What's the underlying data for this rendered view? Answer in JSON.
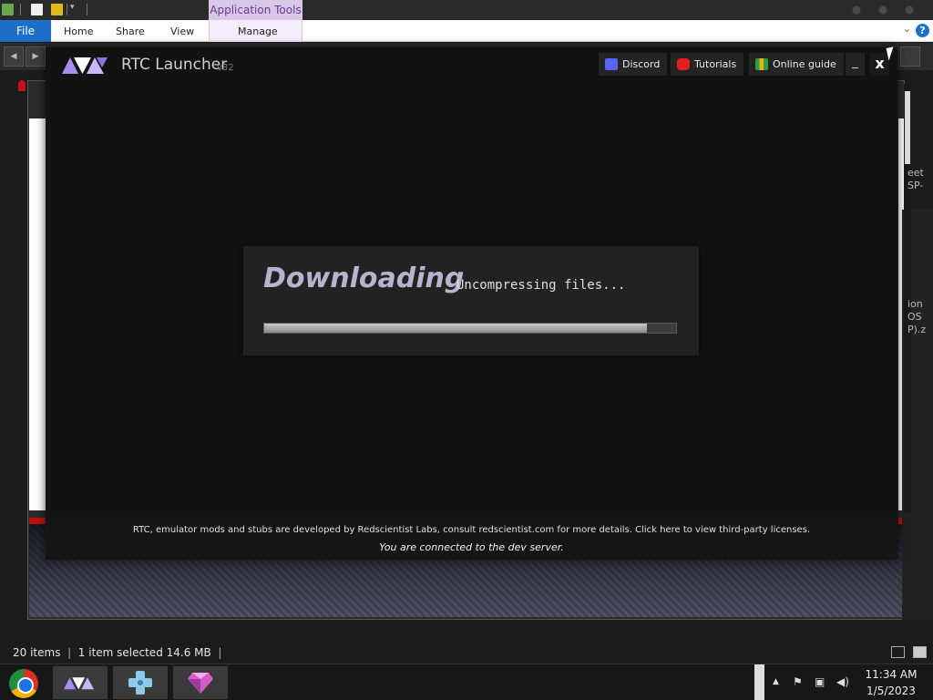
{
  "explorer": {
    "context_tab": "Application Tools",
    "ribbon_tabs": {
      "file": "File",
      "home": "Home",
      "share": "Share",
      "view": "View",
      "manage": "Manage"
    },
    "side_text": [
      "eet",
      "SP-",
      "ion",
      "OS",
      "P).z"
    ]
  },
  "launcher": {
    "title": "RTC Launcher",
    "version": "v32",
    "buttons": {
      "discord": "Discord",
      "tutorials": "Tutorials",
      "guide": "Online guide",
      "minimize": "_",
      "close": "x"
    },
    "download": {
      "heading": "Downloading",
      "status": "Uncompressing files...",
      "progress": 0.93
    },
    "footer": {
      "line1": "RTC, emulator mods and stubs are developed by Redscientist Labs, consult redscientist.com for more details. Click here to view third-party licenses.",
      "line2": "You are connected to the dev server."
    }
  },
  "statusbar": {
    "items": "20 items",
    "selected": "1 item selected",
    "size": "14.6 MB"
  },
  "taskbar": {
    "time": "11:34 AM",
    "date": "1/5/2023"
  },
  "colors": {
    "accent": "#1e6fc7",
    "launcher_logo": "#b49cf0",
    "context_tab": "#d9c7ea"
  }
}
